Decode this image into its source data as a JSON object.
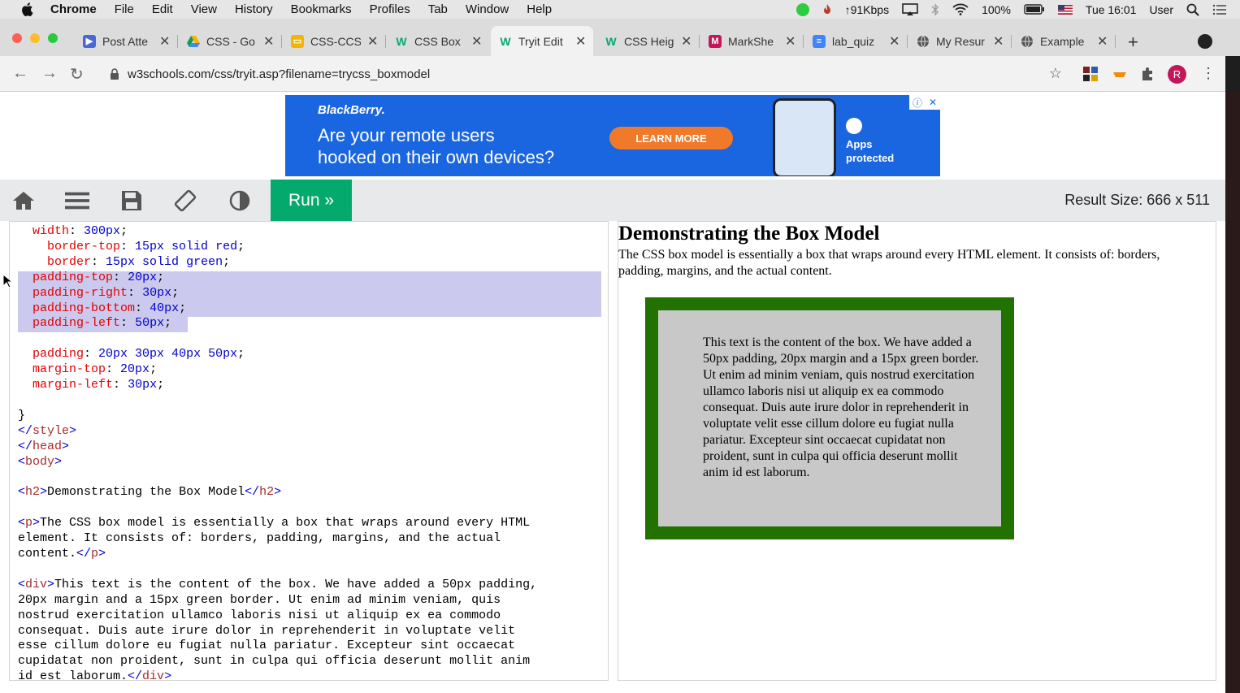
{
  "menubar": {
    "app": "Chrome",
    "items": [
      "File",
      "Edit",
      "View",
      "History",
      "Bookmarks",
      "Profiles",
      "Tab",
      "Window",
      "Help"
    ],
    "network": "↑91Kbps",
    "battery": "100%",
    "datetime": "Tue 16:01",
    "user": "User"
  },
  "tabs": [
    {
      "label": "Post Atte",
      "favicon": "video-icon",
      "color": "#4a67d6"
    },
    {
      "label": "CSS - Go",
      "favicon": "drive-icon",
      "color": "#f4b400"
    },
    {
      "label": "CSS-CCS",
      "favicon": "slides-icon",
      "color": "#f4b400"
    },
    {
      "label": "CSS Box",
      "favicon": "w3schools-icon",
      "color": "#04aa6d"
    },
    {
      "label": "Tryit Edit",
      "favicon": "w3schools-icon",
      "color": "#04aa6d",
      "active": true
    },
    {
      "label": "CSS Heig",
      "favicon": "w3schools-icon",
      "color": "#04aa6d"
    },
    {
      "label": "MarkShe",
      "favicon": "marksheet-icon",
      "color": "#c2185b"
    },
    {
      "label": "lab_quiz",
      "favicon": "docs-icon",
      "color": "#4285f4"
    },
    {
      "label": "My Resur",
      "favicon": "globe-icon",
      "color": "#444444"
    },
    {
      "label": "Example",
      "favicon": "globe-icon",
      "color": "#444444"
    }
  ],
  "address": {
    "url": "w3schools.com/css/tryit.asp?filename=trycss_boxmodel",
    "avatar_letter": "R"
  },
  "ad": {
    "brand": "BlackBerry.",
    "headline_line1": "Are your remote users",
    "headline_line2": "hooked on their own devices?",
    "cta": "LEARN MORE",
    "apps_line1": "Apps",
    "apps_line2": "protected"
  },
  "tryit": {
    "run_label": "Run »",
    "result_size": "Result Size: 666 x 511"
  },
  "code_lines": [
    "  width: 300px;",
    "    border-top: 15px solid red;",
    "    border: 15px solid green;",
    "  padding-top: 20px;",
    "  padding-right: 30px;",
    "  padding-bottom: 40px;",
    "  padding-left: 50px;",
    "",
    "  padding: 20px 30px 40px 50px;",
    "  margin-top: 20px;",
    "  margin-left: 30px;",
    "",
    "}",
    "</style>",
    "</head>",
    "<body>",
    "",
    "<h2>Demonstrating the Box Model</h2>",
    "",
    "<p>The CSS box model is essentially a box that wraps around every HTML",
    "element. It consists of: borders, padding, margins, and the actual",
    "content.</p>",
    "",
    "<div>This text is the content of the box. We have added a 50px padding,",
    "20px margin and a 15px green border. Ut enim ad minim veniam, quis",
    "nostrud exercitation ullamco laboris nisi ut aliquip ex ea commodo",
    "consequat. Duis aute irure dolor in reprehenderit in voluptate velit",
    "esse cillum dolore eu fugiat nulla pariatur. Excepteur sint occaecat",
    "cupidatat non proident, sunt in culpa qui officia deserunt mollit anim",
    "id est laborum.</div>"
  ],
  "result": {
    "heading": "Demonstrating the Box Model",
    "paragraph": "The CSS box model is essentially a box that wraps around every HTML element. It consists of: borders, padding, margins, and the actual content.",
    "box_text": "This text is the content of the box. We have added a 50px padding, 20px margin and a 15px green border. Ut enim ad minim veniam, quis nostrud exercitation ullamco laboris nisi ut aliquip ex ea commodo consequat. Duis aute irure dolor in reprehenderit in voluptate velit esse cillum dolore eu fugiat nulla pariatur. Excepteur sint occaecat cupidatat non proident, sunt in culpa qui officia deserunt mollit anim id est laborum."
  },
  "colors": {
    "w3_green": "#04aa6d",
    "box_border": "#217200",
    "box_bg": "#c8c8c8",
    "selection": "#cbcaee"
  }
}
